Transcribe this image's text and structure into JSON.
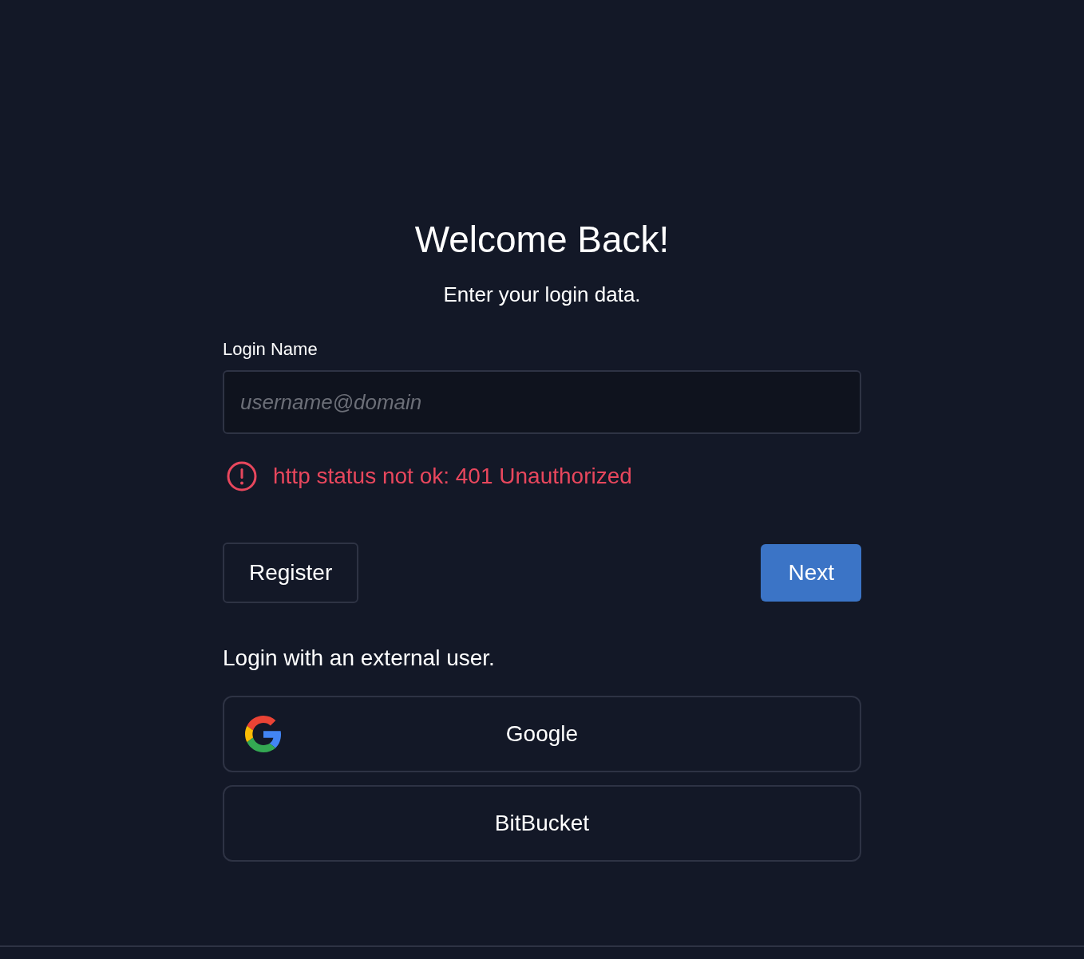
{
  "title": "Welcome Back!",
  "subtitle": "Enter your login data.",
  "login_field": {
    "label": "Login Name",
    "placeholder": "username@domain"
  },
  "error": {
    "message": "http status not ok: 401 Unauthorized"
  },
  "buttons": {
    "secondary": "Register",
    "primary": "Next"
  },
  "external": {
    "heading": "Login with an external user.",
    "providers": [
      {
        "label": "Google",
        "kind": "google"
      },
      {
        "label": "BitBucket",
        "kind": "plain"
      }
    ]
  }
}
